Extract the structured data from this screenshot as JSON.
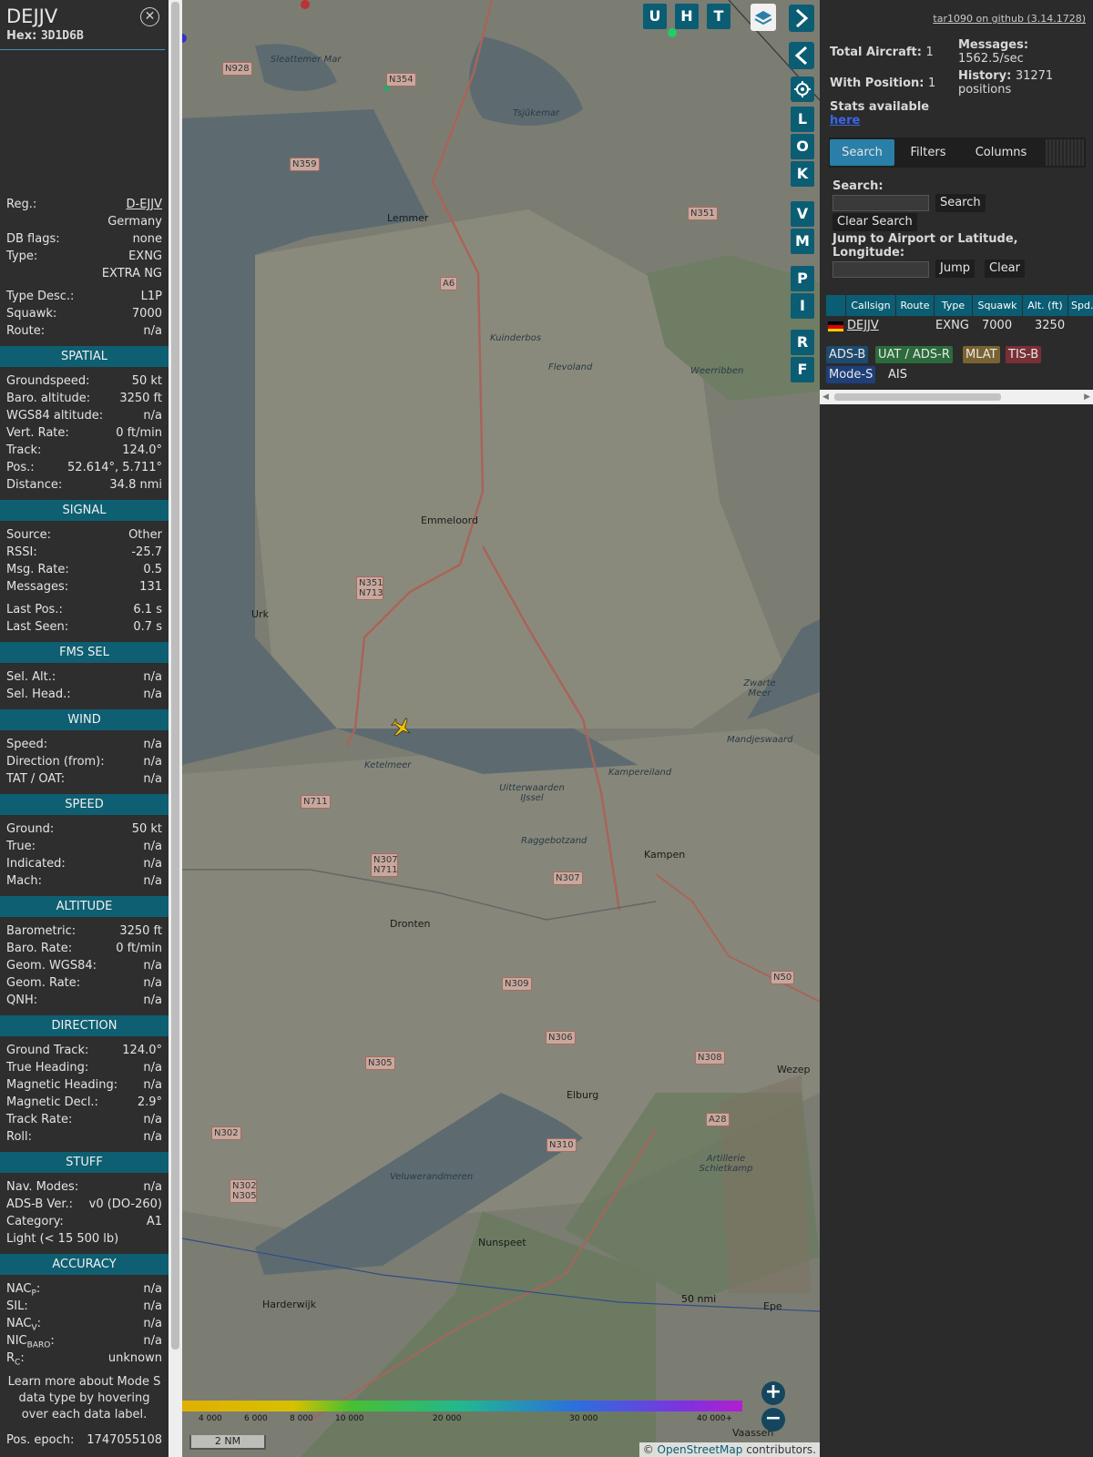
{
  "info": {
    "callsign": "DEJJV",
    "hex_label": "Hex:",
    "hex": "3D1D6B",
    "reg_label": "Reg.:",
    "reg": "D-EJJV",
    "country": "Germany",
    "dbflags_label": "DB flags:",
    "dbflags": "none",
    "type_label": "Type:",
    "type": "EXNG",
    "type_name": "EXTRA NG",
    "typedesc_label": "Type Desc.:",
    "typedesc": "L1P",
    "squawk_label": "Squawk:",
    "squawk": "7000",
    "route_label": "Route:",
    "route": "n/a",
    "spatial": {
      "title": "SPATIAL",
      "rows": [
        {
          "k": "Groundspeed:",
          "v": "50 kt"
        },
        {
          "k": "Baro. altitude:",
          "v": "3250 ft"
        },
        {
          "k": "WGS84 altitude:",
          "v": "n/a"
        },
        {
          "k": "Vert. Rate:",
          "v": "0 ft/min"
        },
        {
          "k": "Track:",
          "v": "124.0°"
        },
        {
          "k": "Pos.:",
          "v": "52.614°, 5.711°"
        },
        {
          "k": "Distance:",
          "v": "34.8 nmi"
        }
      ]
    },
    "signal": {
      "title": "SIGNAL",
      "rows": [
        {
          "k": "Source:",
          "v": "Other"
        },
        {
          "k": "RSSI:",
          "v": "-25.7"
        },
        {
          "k": "Msg. Rate:",
          "v": "0.5"
        },
        {
          "k": "Messages:",
          "v": "131"
        },
        {
          "k": "Last Pos.:",
          "v": "6.1 s"
        },
        {
          "k": "Last Seen:",
          "v": "0.7 s"
        }
      ]
    },
    "fms": {
      "title": "FMS SEL",
      "rows": [
        {
          "k": "Sel. Alt.:",
          "v": "n/a"
        },
        {
          "k": "Sel. Head.:",
          "v": "n/a"
        }
      ]
    },
    "wind": {
      "title": "WIND",
      "rows": [
        {
          "k": "Speed:",
          "v": "n/a"
        },
        {
          "k": "Direction (from):",
          "v": "n/a"
        },
        {
          "k": "TAT / OAT:",
          "v": "n/a"
        }
      ]
    },
    "speed": {
      "title": "SPEED",
      "rows": [
        {
          "k": "Ground:",
          "v": "50 kt"
        },
        {
          "k": "True:",
          "v": "n/a"
        },
        {
          "k": "Indicated:",
          "v": "n/a"
        },
        {
          "k": "Mach:",
          "v": "n/a"
        }
      ]
    },
    "altitude": {
      "title": "ALTITUDE",
      "rows": [
        {
          "k": "Barometric:",
          "v": "3250 ft"
        },
        {
          "k": "Baro. Rate:",
          "v": "0 ft/min"
        },
        {
          "k": "Geom. WGS84:",
          "v": "n/a"
        },
        {
          "k": "Geom. Rate:",
          "v": "n/a"
        },
        {
          "k": "QNH:",
          "v": "n/a"
        }
      ]
    },
    "direction": {
      "title": "DIRECTION",
      "rows": [
        {
          "k": "Ground Track:",
          "v": "124.0°"
        },
        {
          "k": "True Heading:",
          "v": "n/a"
        },
        {
          "k": "Magnetic Heading:",
          "v": "n/a"
        },
        {
          "k": "Magnetic Decl.:",
          "v": "2.9°"
        },
        {
          "k": "Track Rate:",
          "v": "n/a"
        },
        {
          "k": "Roll:",
          "v": "n/a"
        }
      ]
    },
    "stuff": {
      "title": "STUFF",
      "rows": [
        {
          "k": "Nav. Modes:",
          "v": "n/a"
        },
        {
          "k": "ADS-B Ver.:",
          "v": "v0 (DO-260)"
        },
        {
          "k": "Category:",
          "v": "A1"
        }
      ],
      "category_desc": "Light (< 15 500 lb)"
    },
    "accuracy": {
      "title": "ACCURACY",
      "nacp_k": "NAC",
      "nacp_sub": "P",
      "nacp_v": "n/a",
      "sil_k": "SIL:",
      "sil_v": "n/a",
      "nacv_k": "NAC",
      "nacv_sub": "V",
      "nacv_v": "n/a",
      "nic_k": "NIC",
      "nic_sub": "BARO",
      "nic_v": "n/a",
      "rc_k": "R",
      "rc_sub": "C",
      "rc_v": "unknown"
    },
    "learn_more": "Learn more about Mode S data type by hovering over each data label.",
    "pos_epoch_label": "Pos. epoch:",
    "pos_epoch": "1747055108"
  },
  "map": {
    "buttons": [
      "U",
      "H",
      "T"
    ],
    "side_buttons": [
      "L",
      "O",
      "K",
      "V",
      "M",
      "P",
      "I",
      "R",
      "F"
    ],
    "places": [
      {
        "name": "Lemmer"
      },
      {
        "name": "Emmeloord"
      },
      {
        "name": "Urk"
      },
      {
        "name": "Dronten"
      },
      {
        "name": "Kampen"
      },
      {
        "name": "Kampereiland"
      },
      {
        "name": "Elburg"
      },
      {
        "name": "Nunspeet"
      },
      {
        "name": "Harderwijk"
      },
      {
        "name": "Epe"
      },
      {
        "name": "Wezep"
      },
      {
        "name": "Ketelmeer"
      },
      {
        "name": "Flevoland"
      },
      {
        "name": "Weerribben"
      },
      {
        "name": "Mandjeswaard"
      },
      {
        "name": "Veluwerandmeren"
      },
      {
        "name": "Artillerie Schietkamp"
      },
      {
        "name": "Tsjûkemar"
      },
      {
        "name": "Zwarte Meer"
      },
      {
        "name": "Uitterwaarden IJssel"
      },
      {
        "name": "Kuinderbos"
      },
      {
        "name": "Sleattemer Mar"
      },
      {
        "name": "Vaassen"
      },
      {
        "name": "Raggebotzand"
      }
    ],
    "roads": [
      "N928",
      "N354",
      "N359",
      "N351",
      "A6",
      "N351 N713",
      "N711",
      "N307 N711",
      "N307",
      "N309",
      "N306",
      "N305",
      "N302",
      "N302 N305",
      "N310",
      "N308",
      "A28",
      "N50"
    ],
    "range_ring": "50 nmi",
    "altitude_scale": [
      "4 000",
      "6 000",
      "8 000",
      "10 000",
      "20 000",
      "30 000",
      "40 000+"
    ],
    "scale_bar": "2 NM",
    "attribution_symbol": "©",
    "attribution_link": "OpenStreetMap",
    "attribution_rest": "contributors."
  },
  "side": {
    "github_link": "tar1090 on github (3.14.1728)",
    "total_aircraft_label": "Total Aircraft:",
    "total_aircraft": "1",
    "messages_label": "Messages:",
    "messages_rate": "1562.5/sec",
    "with_position_label": "With Position:",
    "with_position": "1",
    "history_label": "History:",
    "history_value": "31271",
    "history_unit": "positions",
    "stats_text": "Stats available",
    "stats_link": "here",
    "tabs": [
      "Search",
      "Filters",
      "Columns"
    ],
    "search_label": "Search:",
    "search_button": "Search",
    "clear_search_button": "Clear Search",
    "jump_label": "Jump to Airport or Latitude, Longitude:",
    "jump_button": "Jump",
    "clear_button": "Clear",
    "table": {
      "headers": [
        "Callsign",
        "Route",
        "Type",
        "Squawk",
        "Alt. (ft)",
        "Spd."
      ],
      "rows": [
        {
          "callsign": "DEJJV",
          "route": "",
          "type": "EXNG",
          "squawk": "7000",
          "alt": "3250"
        }
      ]
    },
    "legend": [
      {
        "label": "ADS-B",
        "color": "#1e4a6e"
      },
      {
        "label": "UAT / ADS-R",
        "color": "#2c6b3c"
      },
      {
        "label": "MLAT",
        "color": "#7a6330"
      },
      {
        "label": "TIS-B",
        "color": "#7a2f36"
      },
      {
        "label": "Mode-S",
        "color": "#1f3f7a"
      },
      {
        "label": "AIS",
        "color": "#2b2b2b"
      }
    ]
  }
}
